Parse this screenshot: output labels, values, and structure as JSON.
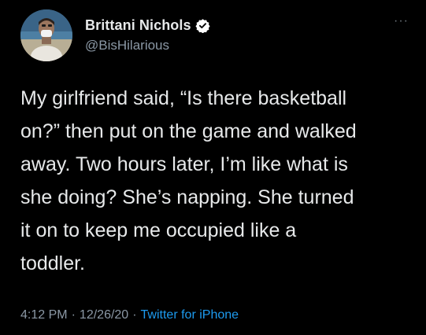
{
  "author": {
    "display_name": "Brittani Nichols",
    "handle": "@BisHilarious",
    "verified": true
  },
  "tweet": {
    "lines": [
      "My girlfriend said, “Is there basketball",
      "on?” then put on the game and walked",
      "away. Two hours later, I’m like what is",
      "she doing? She’s napping. She turned",
      "it on to keep me occupied like a",
      "toddler."
    ]
  },
  "meta": {
    "time": "4:12 PM",
    "date": "12/26/20",
    "source": "Twitter for iPhone",
    "separator": "·"
  },
  "more_menu": "···",
  "colors": {
    "background": "#000000",
    "text": "#e7e9ea",
    "secondary": "#8b98a5",
    "accent": "#1d9bf0"
  }
}
